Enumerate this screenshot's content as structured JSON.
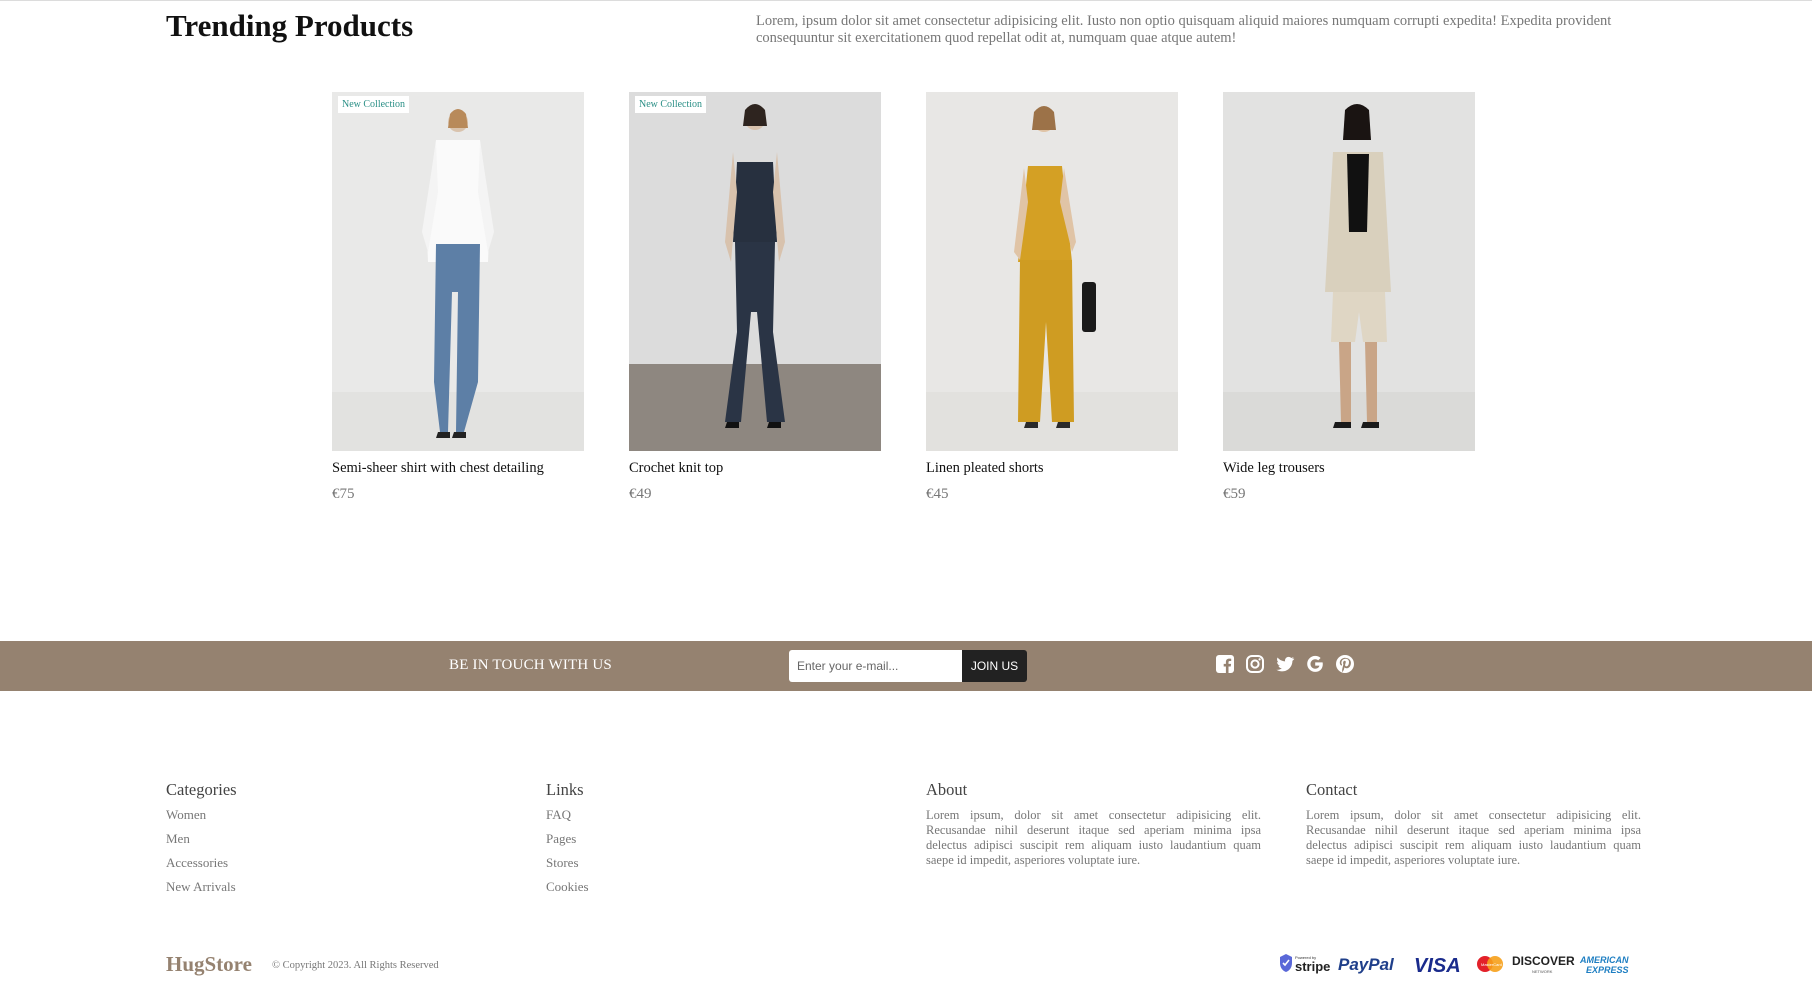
{
  "header": {
    "title": "Trending Products",
    "intro": "Lorem, ipsum dolor sit amet consectetur adipisicing elit. Iusto non optio quisquam aliquid maiores numquam corrupti expedita! Expedita provident consequuntur sit exercitationem quod repellat odit at, numquam quae atque autem!"
  },
  "products": [
    {
      "name": "Semi-sheer shirt with chest detailing",
      "price": "€75",
      "badge": "New Collection"
    },
    {
      "name": "Crochet knit top",
      "price": "€49",
      "badge": "New Collection"
    },
    {
      "name": "Linen pleated shorts",
      "price": "€45",
      "badge": ""
    },
    {
      "name": "Wide leg trousers",
      "price": "€59",
      "badge": ""
    }
  ],
  "newsletter": {
    "title": "BE IN TOUCH WITH US",
    "placeholder": "Enter your e-mail...",
    "button": "JOIN US",
    "social_icons": [
      "facebook-icon",
      "instagram-icon",
      "twitter-icon",
      "google-icon",
      "pinterest-icon"
    ]
  },
  "footer": {
    "categories": {
      "heading": "Categories",
      "items": [
        "Women",
        "Men",
        "Accessories",
        "New Arrivals"
      ]
    },
    "links": {
      "heading": "Links",
      "items": [
        "FAQ",
        "Pages",
        "Stores",
        "Cookies"
      ]
    },
    "about": {
      "heading": "About",
      "text": "Lorem ipsum, dolor sit amet consectetur adipisicing elit. Recusandae nihil deserunt itaque sed aperiam minima ipsa delectus adipisci suscipit rem aliquam iusto laudantium quam saepe id impedit, asperiores voluptate iure."
    },
    "contact": {
      "heading": "Contact",
      "text": "Lorem ipsum, dolor sit amet consectetur adipisicing elit. Recusandae nihil deserunt itaque sed aperiam minima ipsa delectus adipisci suscipit rem aliquam iusto laudantium quam saepe id impedit, asperiores voluptate iure."
    },
    "brand": "HugStore",
    "copyright": "© Copyright 2023. All Rights Reserved",
    "payment_logos": [
      "stripe-logo",
      "paypal-logo",
      "visa-logo",
      "mastercard-logo",
      "discover-logo",
      "american-express-logo"
    ],
    "payment_text": {
      "stripe_small": "Powered by",
      "stripe": "stripe",
      "paypal": "PayPal",
      "visa": "VISA",
      "mastercard": "MasterCard",
      "discover": "DISCOVER",
      "discover_small": "NETWORK",
      "amex_line1": "AMERICAN",
      "amex_line2": "EXPRESS"
    }
  },
  "colors": {
    "accent": "#958270",
    "badge_text": "#2a8f86",
    "dark_button": "#222222"
  }
}
